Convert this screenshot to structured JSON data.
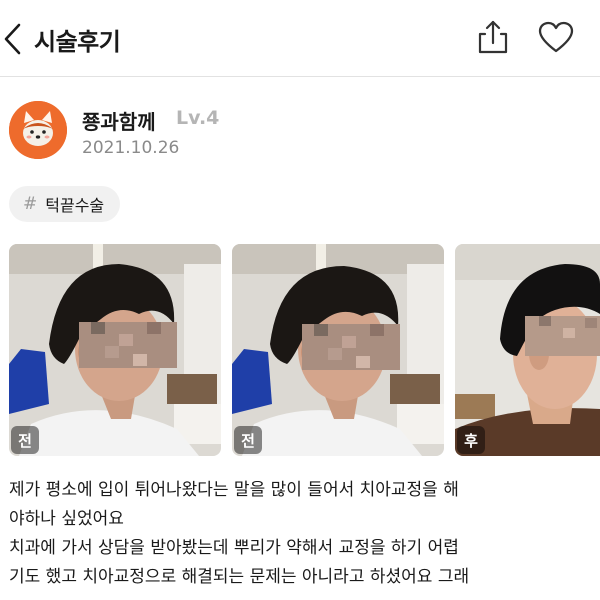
{
  "header": {
    "title": "시술후기",
    "back_icon": "chevron-left-icon",
    "share_icon": "share-icon",
    "like_icon": "heart-icon"
  },
  "author": {
    "name": "쭁과함께",
    "level": "Lv.4",
    "date": "2021.10.26",
    "avatar_icon": "fox-avatar-icon",
    "avatar_color": "#ee6b2c"
  },
  "tag": {
    "hash": "#",
    "label": "턱끝수술"
  },
  "photos": [
    {
      "badge": "전"
    },
    {
      "badge": "전"
    },
    {
      "badge": "후"
    }
  ],
  "body": {
    "lines": [
      "제가 평소에 입이 튀어나왔다는 말을 많이 들어서 치아교정을 해",
      "야하나 싶었어요",
      "치과에 가서 상담을 받아봤는데 뿌리가 약해서 교정을 하기 어렵",
      "기도 했고 치아교정으로 해결되는 문제는 아니라고 하셨어요 그래"
    ]
  }
}
